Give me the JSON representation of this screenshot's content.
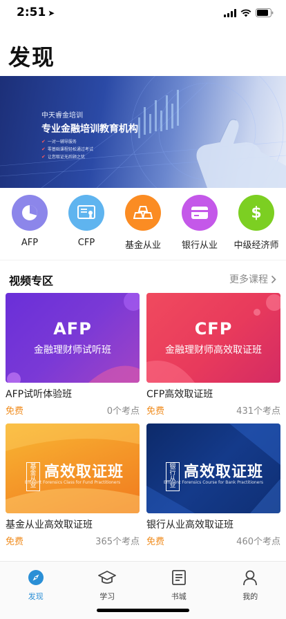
{
  "status_bar": {
    "time": "2:51"
  },
  "header": {
    "title": "发现"
  },
  "banner": {
    "subtitle": "中天睿金培训",
    "title": "专业金融培训教育机构",
    "bullets": [
      "一对一辅导服务",
      "零基础课程轻松通过考试",
      "让您取证无后顾之忧"
    ]
  },
  "categories": [
    {
      "label": "AFP",
      "icon": "pie-chart-icon",
      "color": "#8c86ea"
    },
    {
      "label": "CFP",
      "icon": "certificate-icon",
      "color": "#5fb4ef"
    },
    {
      "label": "基金从业",
      "icon": "gold-bars-icon",
      "color": "#fb8c23"
    },
    {
      "label": "银行从业",
      "icon": "bank-card-icon",
      "color": "#c458e9"
    },
    {
      "label": "中级经济师",
      "icon": "dollar-icon",
      "color": "#7ccf22"
    }
  ],
  "section": {
    "title": "视频专区",
    "more": "更多课程"
  },
  "courses": [
    {
      "cover_big": "AFP",
      "cover_small": "金融理财师试听班",
      "title": "AFP试听体验班",
      "price": "免费",
      "count": "0个考点"
    },
    {
      "cover_big": "CFP",
      "cover_small": "金融理财师高效取证班",
      "title": "CFP高效取证班",
      "price": "免费",
      "count": "431个考点"
    },
    {
      "cover_badge": "基金从业",
      "cover_heading": "高效取证班",
      "cover_eng": "Efficient Forensics Class for Fund Practitioners",
      "title": "基金从业高效取证班",
      "price": "免费",
      "count": "365个考点"
    },
    {
      "cover_badge": "银行从业",
      "cover_heading": "高效取证班",
      "cover_eng": "Efficient Forensics Course for Bank Practitioners",
      "title": "银行从业高效取证班",
      "price": "免费",
      "count": "460个考点"
    }
  ],
  "tabs": [
    {
      "label": "发现",
      "icon": "compass-icon",
      "active": true
    },
    {
      "label": "学习",
      "icon": "graduation-cap-icon",
      "active": false
    },
    {
      "label": "书城",
      "icon": "book-icon",
      "active": false
    },
    {
      "label": "我的",
      "icon": "user-icon",
      "active": false
    }
  ],
  "colors": {
    "accent": "#2a8fd6",
    "price": "#f08c1e"
  }
}
